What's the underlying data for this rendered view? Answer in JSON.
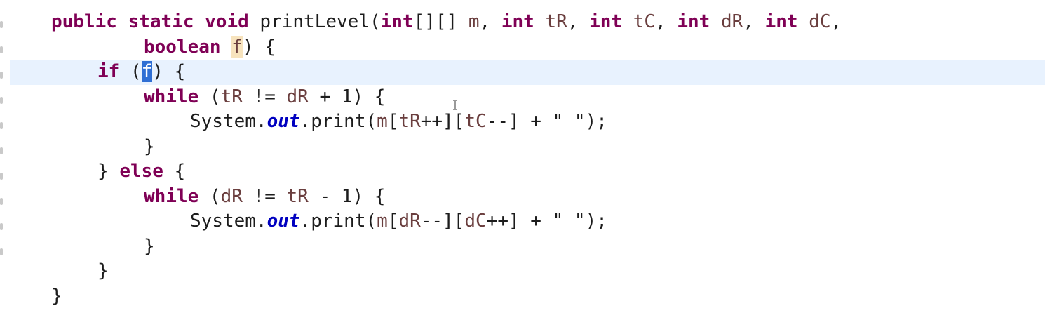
{
  "editor": {
    "lines": [
      {
        "indent": "  ",
        "tokens": [
          {
            "t": "public",
            "c": "kw"
          },
          {
            "t": " ",
            "c": "txt"
          },
          {
            "t": "static",
            "c": "kw"
          },
          {
            "t": " ",
            "c": "txt"
          },
          {
            "t": "void",
            "c": "kw"
          },
          {
            "t": " printLevel(",
            "c": "txt"
          },
          {
            "t": "int",
            "c": "kw"
          },
          {
            "t": "[][] ",
            "c": "txt"
          },
          {
            "t": "m",
            "c": "param"
          },
          {
            "t": ", ",
            "c": "txt"
          },
          {
            "t": "int",
            "c": "kw"
          },
          {
            "t": " ",
            "c": "txt"
          },
          {
            "t": "tR",
            "c": "param"
          },
          {
            "t": ", ",
            "c": "txt"
          },
          {
            "t": "int",
            "c": "kw"
          },
          {
            "t": " ",
            "c": "txt"
          },
          {
            "t": "tC",
            "c": "param"
          },
          {
            "t": ", ",
            "c": "txt"
          },
          {
            "t": "int",
            "c": "kw"
          },
          {
            "t": " ",
            "c": "txt"
          },
          {
            "t": "dR",
            "c": "param"
          },
          {
            "t": ", ",
            "c": "txt"
          },
          {
            "t": "int",
            "c": "kw"
          },
          {
            "t": " ",
            "c": "txt"
          },
          {
            "t": "dC",
            "c": "param"
          },
          {
            "t": ",",
            "c": "txt"
          }
        ]
      },
      {
        "indent": "          ",
        "tokens": [
          {
            "t": "boolean",
            "c": "kw"
          },
          {
            "t": " ",
            "c": "txt"
          },
          {
            "t": "f",
            "c": "param hl-occ"
          },
          {
            "t": ") {",
            "c": "txt"
          }
        ]
      },
      {
        "indent": "      ",
        "current": true,
        "tokens": [
          {
            "t": "if",
            "c": "kw"
          },
          {
            "t": " (",
            "c": "txt"
          },
          {
            "t": "f",
            "c": "sel"
          },
          {
            "t": ") {",
            "c": "txt"
          }
        ]
      },
      {
        "indent": "          ",
        "tokens": [
          {
            "t": "while",
            "c": "kw"
          },
          {
            "t": " (",
            "c": "txt"
          },
          {
            "t": "tR",
            "c": "param"
          },
          {
            "t": " != ",
            "c": "txt"
          },
          {
            "t": "dR",
            "c": "param"
          },
          {
            "t": " + 1) {",
            "c": "txt"
          }
        ]
      },
      {
        "indent": "              ",
        "tokens": [
          {
            "t": "System.",
            "c": "txt"
          },
          {
            "t": "out",
            "c": "field"
          },
          {
            "t": ".print(",
            "c": "txt"
          },
          {
            "t": "m",
            "c": "param"
          },
          {
            "t": "[",
            "c": "txt"
          },
          {
            "t": "tR",
            "c": "param"
          },
          {
            "t": "++][",
            "c": "txt"
          },
          {
            "t": "tC",
            "c": "param"
          },
          {
            "t": "--] + \" \");",
            "c": "txt"
          }
        ]
      },
      {
        "indent": "          ",
        "tokens": [
          {
            "t": "}",
            "c": "txt"
          }
        ]
      },
      {
        "indent": "      ",
        "tokens": [
          {
            "t": "} ",
            "c": "txt"
          },
          {
            "t": "else",
            "c": "kw"
          },
          {
            "t": " {",
            "c": "txt"
          }
        ]
      },
      {
        "indent": "          ",
        "tokens": [
          {
            "t": "while",
            "c": "kw"
          },
          {
            "t": " (",
            "c": "txt"
          },
          {
            "t": "dR",
            "c": "param"
          },
          {
            "t": " != ",
            "c": "txt"
          },
          {
            "t": "tR",
            "c": "param"
          },
          {
            "t": " - 1) {",
            "c": "txt"
          }
        ]
      },
      {
        "indent": "              ",
        "tokens": [
          {
            "t": "System.",
            "c": "txt"
          },
          {
            "t": "out",
            "c": "field"
          },
          {
            "t": ".print(",
            "c": "txt"
          },
          {
            "t": "m",
            "c": "param"
          },
          {
            "t": "[",
            "c": "txt"
          },
          {
            "t": "dR",
            "c": "param"
          },
          {
            "t": "--][",
            "c": "txt"
          },
          {
            "t": "dC",
            "c": "param"
          },
          {
            "t": "++] + \" \");",
            "c": "txt"
          }
        ]
      },
      {
        "indent": "          ",
        "tokens": [
          {
            "t": "}",
            "c": "txt"
          }
        ]
      },
      {
        "indent": "      ",
        "tokens": [
          {
            "t": "}",
            "c": "txt"
          }
        ]
      },
      {
        "indent": "  ",
        "tokens": [
          {
            "t": "}",
            "c": "txt"
          }
        ]
      }
    ]
  },
  "colors": {
    "keyword": "#7f0055",
    "parameter": "#6a3e3e",
    "static_field": "#0000c0",
    "current_line": "#e8f2fe",
    "selection": "#2f6fd4",
    "occurrence_highlight": "#f7e3bd"
  },
  "icons": {
    "text_cursor": "i-beam-cursor-icon"
  }
}
